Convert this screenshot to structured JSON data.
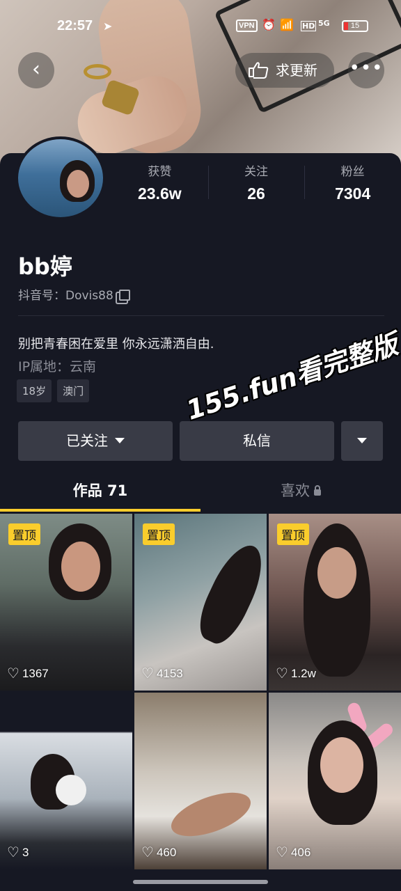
{
  "status_bar": {
    "time": "22:57",
    "vpn": "VPN",
    "battery": "15",
    "network": "5G",
    "hd": "HD"
  },
  "header": {
    "update_label": "求更新",
    "more_label": "•••"
  },
  "stats": [
    {
      "label": "获赞",
      "value": "23.6w"
    },
    {
      "label": "关注",
      "value": "26"
    },
    {
      "label": "粉丝",
      "value": "7304"
    }
  ],
  "profile": {
    "name": "bb婷",
    "douyin_id": "抖音号：Dovis88",
    "bio": "别把青春困在爱里 你永远潇洒自由.",
    "ip": "IP属地：云南",
    "tags": [
      "18岁",
      "澳门"
    ]
  },
  "actions": {
    "follow_label": "已关注",
    "message_label": "私信"
  },
  "watermark": "155.fun看完整版",
  "tabs": [
    {
      "label": "作品 71"
    },
    {
      "label": "喜欢"
    }
  ],
  "videos": [
    {
      "pinned": "置顶",
      "likes": "1367"
    },
    {
      "pinned": "置顶",
      "likes": "4153"
    },
    {
      "pinned": "置顶",
      "likes": "1.2w"
    },
    {
      "pinned": "",
      "likes": "3"
    },
    {
      "pinned": "",
      "likes": "460"
    },
    {
      "pinned": "",
      "likes": "406"
    }
  ],
  "colors": {
    "background": "#161823",
    "accent": "#facd2c",
    "button": "#393b46"
  }
}
